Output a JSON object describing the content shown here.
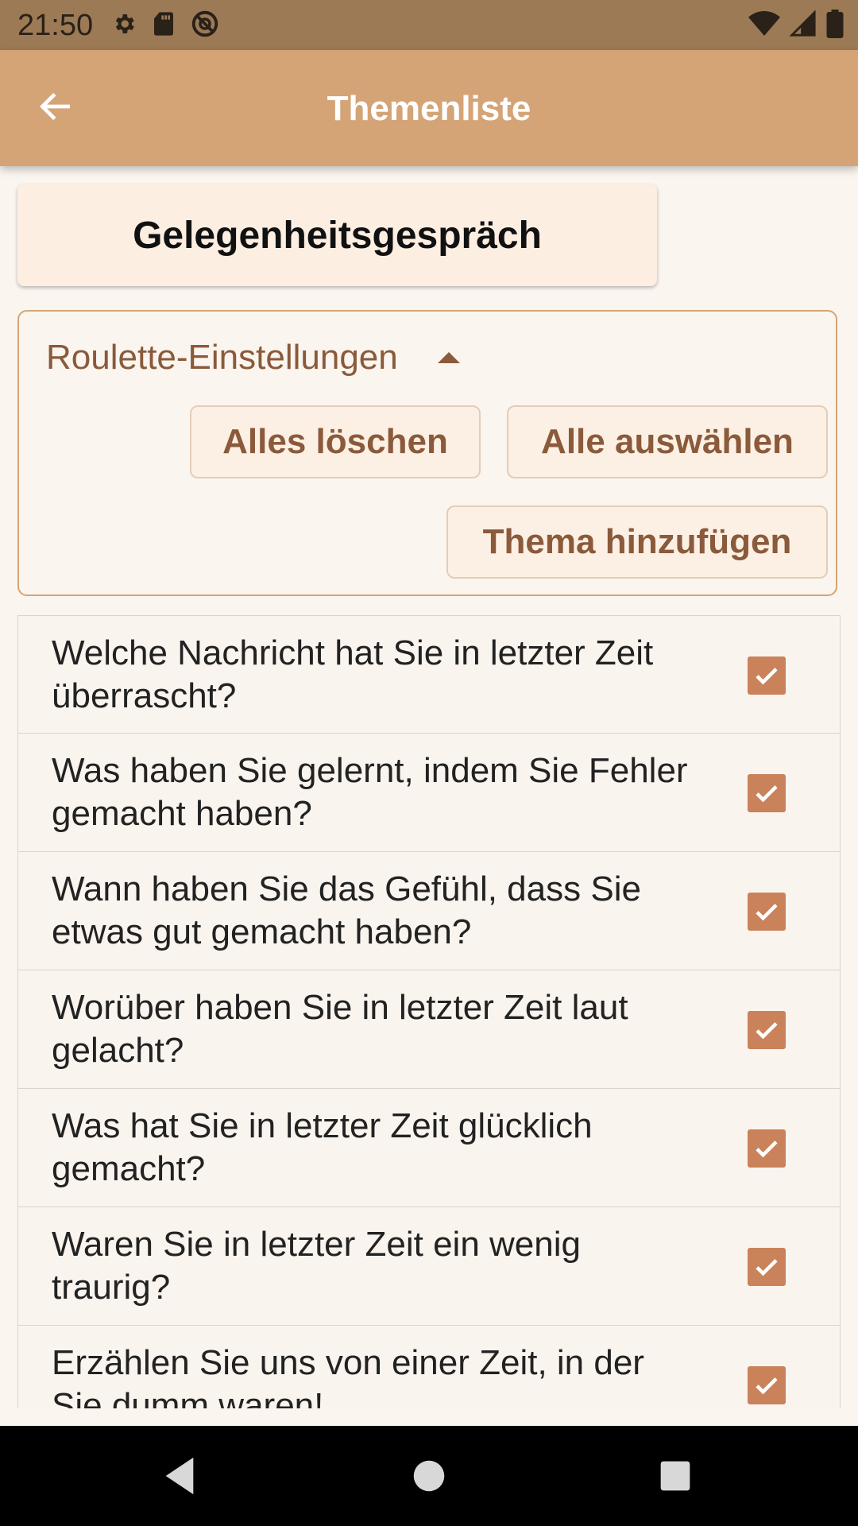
{
  "status_bar": {
    "time": "21:50",
    "left_icons": [
      "gear-icon",
      "sd-card-icon",
      "no-disturb-icon"
    ],
    "right_icons": [
      "wifi-icon",
      "signal-icon",
      "battery-icon"
    ]
  },
  "app_bar": {
    "back_icon": "arrow-back-icon",
    "title": "Themenliste"
  },
  "topic": {
    "title": "Gelegenheitsgespräch"
  },
  "settings": {
    "title": "Roulette-Einstellungen",
    "expanded": true,
    "clear_all_label": "Alles löschen",
    "select_all_label": "Alle auswählen",
    "add_topic_label": "Thema hinzufügen"
  },
  "topics": [
    {
      "text": "Welche Nachricht hat Sie in letzter Zeit überrascht?",
      "checked": true
    },
    {
      "text": "Was haben Sie gelernt, indem Sie Fehler gemacht haben?",
      "checked": true
    },
    {
      "text": "Wann haben Sie das Gefühl, dass Sie etwas gut gemacht haben?",
      "checked": true
    },
    {
      "text": "Worüber haben Sie in letzter Zeit laut gelacht?",
      "checked": true
    },
    {
      "text": "Was hat Sie in letzter Zeit glücklich gemacht?",
      "checked": true
    },
    {
      "text": "Waren Sie in letzter Zeit ein wenig traurig?",
      "checked": true
    },
    {
      "text": "Erzählen Sie uns von einer Zeit, in der Sie dumm waren!",
      "checked": true
    }
  ],
  "nav_bar": {
    "buttons": [
      "nav-back-icon",
      "nav-home-icon",
      "nav-recents-icon"
    ]
  },
  "colors": {
    "status_bar": "#9c7a56",
    "app_bar": "#d4a476",
    "accent": "#8a5a3b",
    "checkbox": "#c9825a",
    "background": "#fbf5ef"
  }
}
